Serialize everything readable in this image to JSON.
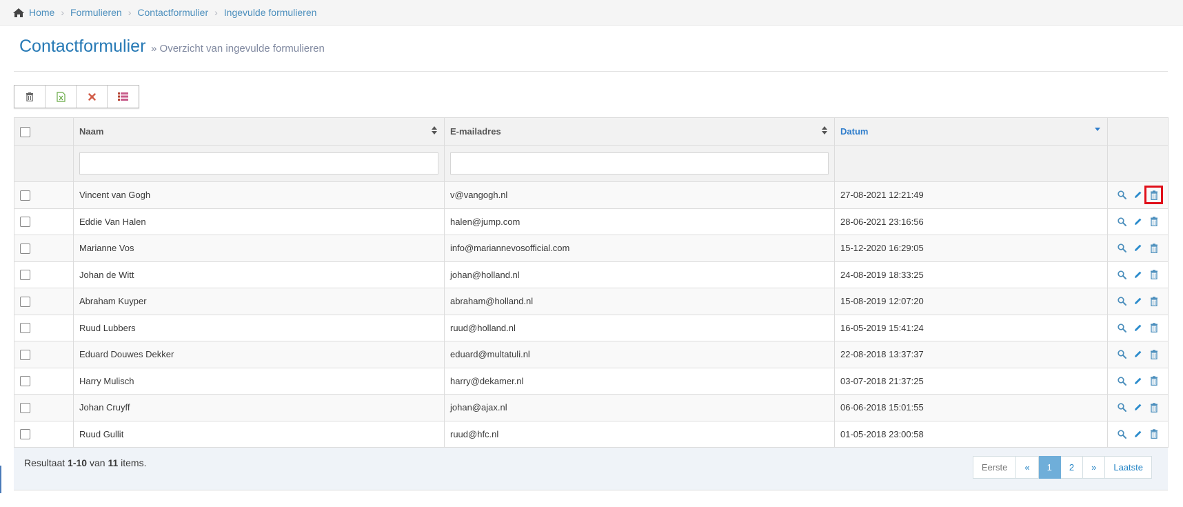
{
  "breadcrumb": {
    "home": "Home",
    "items": [
      "Formulieren",
      "Contactformulier",
      "Ingevulde formulieren"
    ]
  },
  "header": {
    "title": "Contactformulier",
    "subtitle": "» Overzicht van ingevulde formulieren"
  },
  "toolbar": [
    "trash-icon",
    "excel-export-icon",
    "close-icon",
    "list-icon"
  ],
  "columns": {
    "name": "Naam",
    "email": "E-mailadres",
    "date": "Datum"
  },
  "rows": [
    {
      "name": "Vincent van Gogh",
      "email": "v@vangogh.nl",
      "date": "27-08-2021 12:21:49"
    },
    {
      "name": "Eddie Van Halen",
      "email": "halen@jump.com",
      "date": "28-06-2021 23:16:56"
    },
    {
      "name": "Marianne Vos",
      "email": "info@mariannevosofficial.com",
      "date": "15-12-2020 16:29:05"
    },
    {
      "name": "Johan de Witt",
      "email": "johan@holland.nl",
      "date": "24-08-2019 18:33:25"
    },
    {
      "name": "Abraham Kuyper",
      "email": "abraham@holland.nl",
      "date": "15-08-2019 12:07:20"
    },
    {
      "name": "Ruud Lubbers",
      "email": "ruud@holland.nl",
      "date": "16-05-2019 15:41:24"
    },
    {
      "name": "Eduard Douwes Dekker",
      "email": "eduard@multatuli.nl",
      "date": "22-08-2018 13:37:37"
    },
    {
      "name": "Harry Mulisch",
      "email": "harry@dekamer.nl",
      "date": "03-07-2018 21:37:25"
    },
    {
      "name": "Johan Cruyff",
      "email": "johan@ajax.nl",
      "date": "06-06-2018 15:01:55"
    },
    {
      "name": "Ruud Gullit",
      "email": "ruud@hfc.nl",
      "date": "01-05-2018 23:00:58"
    }
  ],
  "footer": {
    "prefix": "Resultaat ",
    "range": "1-10",
    "middle": " van ",
    "total": "11",
    "suffix": " items."
  },
  "pagination": [
    "Eerste",
    "«",
    "1",
    "2",
    "»",
    "Laatste"
  ],
  "colors": {
    "accent": "#2679b5",
    "link": "#4c8fbd",
    "highlight": "#e0101a",
    "pager_active": "#6faed9"
  }
}
